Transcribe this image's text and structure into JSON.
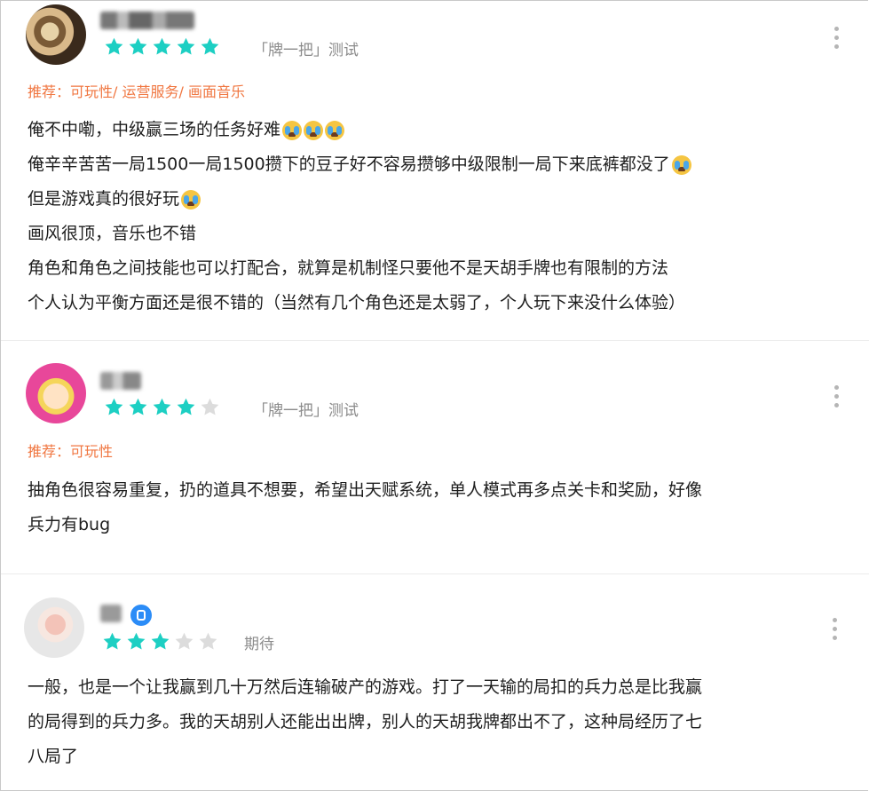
{
  "colors": {
    "star_on": "#1dcfc3",
    "star_off": "#dcdcdc",
    "recommend": "#f07640",
    "tag": "#8b8b8b"
  },
  "reviews": [
    {
      "rating": 5,
      "tag": "「牌一把」测试",
      "recommend": "推荐：可玩性/ 运营服务/ 画面音乐",
      "lines": [
        {
          "text": "俺不中嘞，中级赢三场的任务好难",
          "emojis": 3
        },
        {
          "text": "俺辛辛苦苦一局1500一局1500攒下的豆子好不容易攒够中级限制一局下来底裤都没了",
          "emojis": 1
        },
        {
          "text": "但是游戏真的很好玩",
          "emojis": 1
        },
        {
          "text": "画风很顶，音乐也不错",
          "emojis": 0
        },
        {
          "text": "角色和角色之间技能也可以打配合，就算是机制怪只要他不是天胡手牌也有限制的方法",
          "emojis": 0
        },
        {
          "text": "个人认为平衡方面还是很不错的（当然有几个角色还是太弱了，个人玩下来没什么体验）",
          "emojis": 0
        }
      ]
    },
    {
      "rating": 4,
      "tag": "「牌一把」测试",
      "recommend": "推荐：可玩性",
      "lines": [
        {
          "text": "抽角色很容易重复，扔的道具不想要，希望出天赋系统，单人模式再多点关卡和奖励，好像",
          "emojis": 0
        },
        {
          "text": "兵力有bug",
          "emojis": 0
        }
      ]
    },
    {
      "rating": 3,
      "tag": "期待",
      "lines": [
        {
          "text": "一般，也是一个让我赢到几十万然后连输破产的游戏。打了一天输的局扣的兵力总是比我赢",
          "emojis": 0
        },
        {
          "text": "的局得到的兵力多。我的天胡别人还能出出牌，别人的天胡我牌都出不了，这种局经历了七",
          "emojis": 0
        },
        {
          "text": "八局了",
          "emojis": 0
        }
      ]
    }
  ]
}
